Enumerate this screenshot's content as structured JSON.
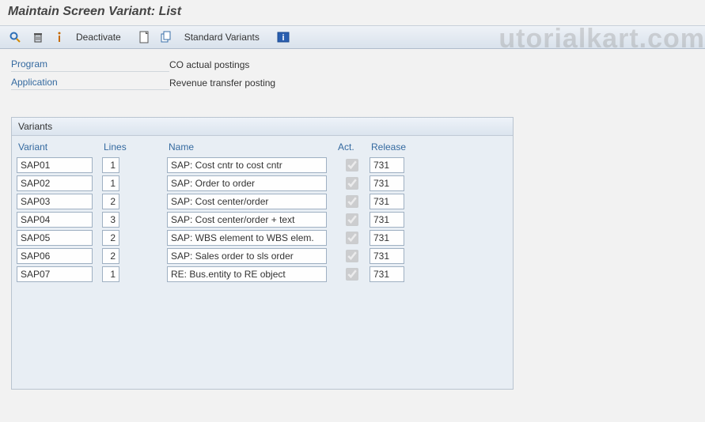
{
  "title": "Maintain Screen Variant: List",
  "watermark": "utorialkart.com",
  "toolbar": {
    "deactivate_label": "Deactivate",
    "standard_variants_label": "Standard Variants"
  },
  "info": {
    "program_label": "Program",
    "program_value": "CO actual postings",
    "application_label": "Application",
    "application_value": "Revenue transfer posting"
  },
  "panel": {
    "title": "Variants",
    "columns": {
      "variant": "Variant",
      "lines": "Lines",
      "name": "Name",
      "act": "Act.",
      "release": "Release"
    },
    "rows": [
      {
        "variant": "SAP01",
        "lines": "1",
        "name": "SAP: Cost cntr to cost cntr",
        "active": true,
        "release": "731"
      },
      {
        "variant": "SAP02",
        "lines": "1",
        "name": "SAP: Order to order",
        "active": true,
        "release": "731"
      },
      {
        "variant": "SAP03",
        "lines": "2",
        "name": "SAP: Cost center/order",
        "active": true,
        "release": "731"
      },
      {
        "variant": "SAP04",
        "lines": "3",
        "name": "SAP: Cost center/order + text",
        "active": true,
        "release": "731"
      },
      {
        "variant": "SAP05",
        "lines": "2",
        "name": "SAP: WBS element to WBS elem.",
        "active": true,
        "release": "731"
      },
      {
        "variant": "SAP06",
        "lines": "2",
        "name": "SAP: Sales order to sls order",
        "active": true,
        "release": "731"
      },
      {
        "variant": "SAP07",
        "lines": "1",
        "name": "RE: Bus.entity to RE object",
        "active": true,
        "release": "731"
      }
    ]
  }
}
